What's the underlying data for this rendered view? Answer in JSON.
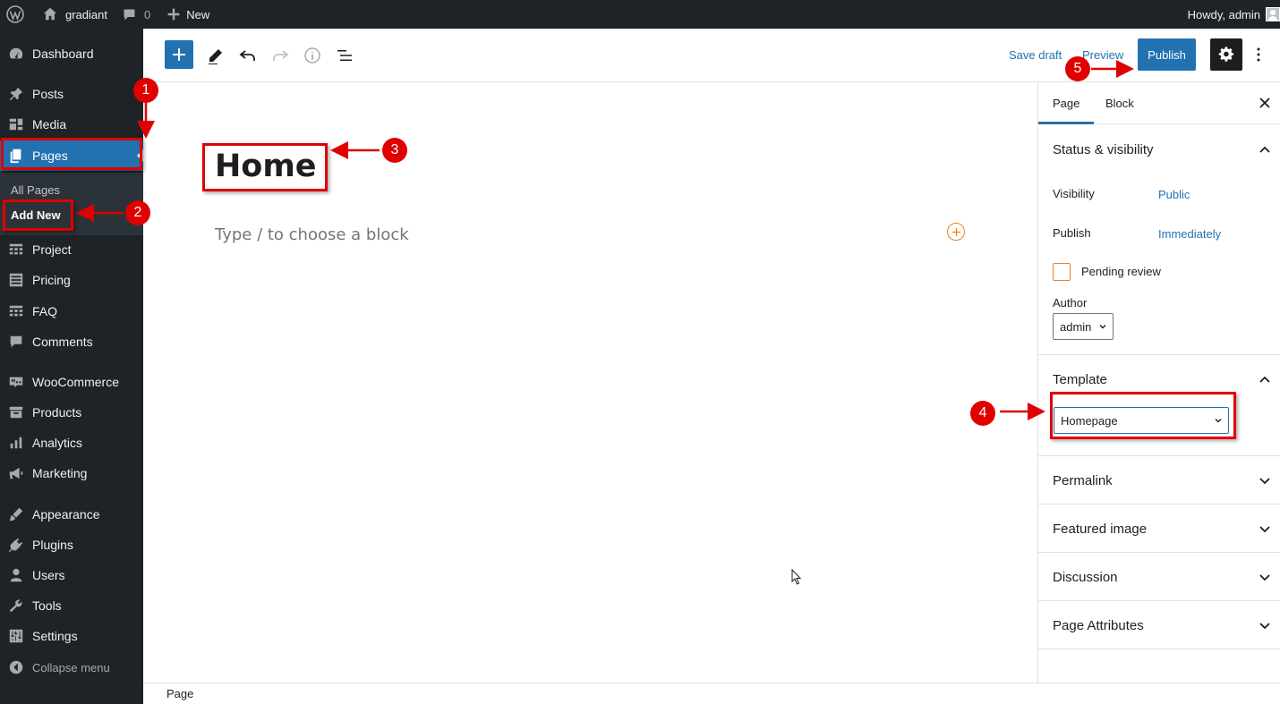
{
  "admin_bar": {
    "site_name": "gradiant",
    "comments_count": "0",
    "new_label": "New",
    "greeting": "Howdy, admin"
  },
  "sidebar": {
    "items": [
      {
        "label": "Dashboard",
        "icon": "dashboard-icon"
      },
      {
        "label": "Posts",
        "icon": "pin-icon"
      },
      {
        "label": "Media",
        "icon": "media-icon"
      },
      {
        "label": "Pages",
        "icon": "pages-icon"
      },
      {
        "label": "Project",
        "icon": "grid-icon"
      },
      {
        "label": "Pricing",
        "icon": "list-icon"
      },
      {
        "label": "FAQ",
        "icon": "grid-icon"
      },
      {
        "label": "Comments",
        "icon": "comment-icon"
      },
      {
        "label": "WooCommerce",
        "icon": "woo-icon"
      },
      {
        "label": "Products",
        "icon": "archive-icon"
      },
      {
        "label": "Analytics",
        "icon": "bar-chart-icon"
      },
      {
        "label": "Marketing",
        "icon": "megaphone-icon"
      },
      {
        "label": "Appearance",
        "icon": "brush-icon"
      },
      {
        "label": "Plugins",
        "icon": "plug-icon"
      },
      {
        "label": "Users",
        "icon": "user-icon"
      },
      {
        "label": "Tools",
        "icon": "wrench-icon"
      },
      {
        "label": "Settings",
        "icon": "sliders-icon"
      }
    ],
    "submenu": {
      "all_pages": "All Pages",
      "add_new": "Add New"
    },
    "collapse_label": "Collapse menu"
  },
  "toolbar": {
    "save_draft": "Save draft",
    "preview": "Preview",
    "publish": "Publish"
  },
  "editor": {
    "title": "Home",
    "block_placeholder": "Type / to choose a block"
  },
  "settings_sidebar": {
    "tabs": [
      "Page",
      "Block"
    ],
    "status_visibility": {
      "heading": "Status & visibility",
      "visibility_label": "Visibility",
      "visibility_value": "Public",
      "publish_label": "Publish",
      "publish_value": "Immediately",
      "pending_review": "Pending review",
      "author_label": "Author",
      "author_value": "admin"
    },
    "template": {
      "heading": "Template",
      "selected": "Homepage"
    },
    "panels": [
      "Permalink",
      "Featured image",
      "Discussion",
      "Page Attributes"
    ]
  },
  "footer": {
    "breadcrumb": "Page"
  },
  "annotations": [
    "1",
    "2",
    "3",
    "4",
    "5"
  ],
  "colors": {
    "admin_dark": "#1d2327",
    "accent_blue": "#2271b1",
    "annotation_red": "#e00000"
  }
}
